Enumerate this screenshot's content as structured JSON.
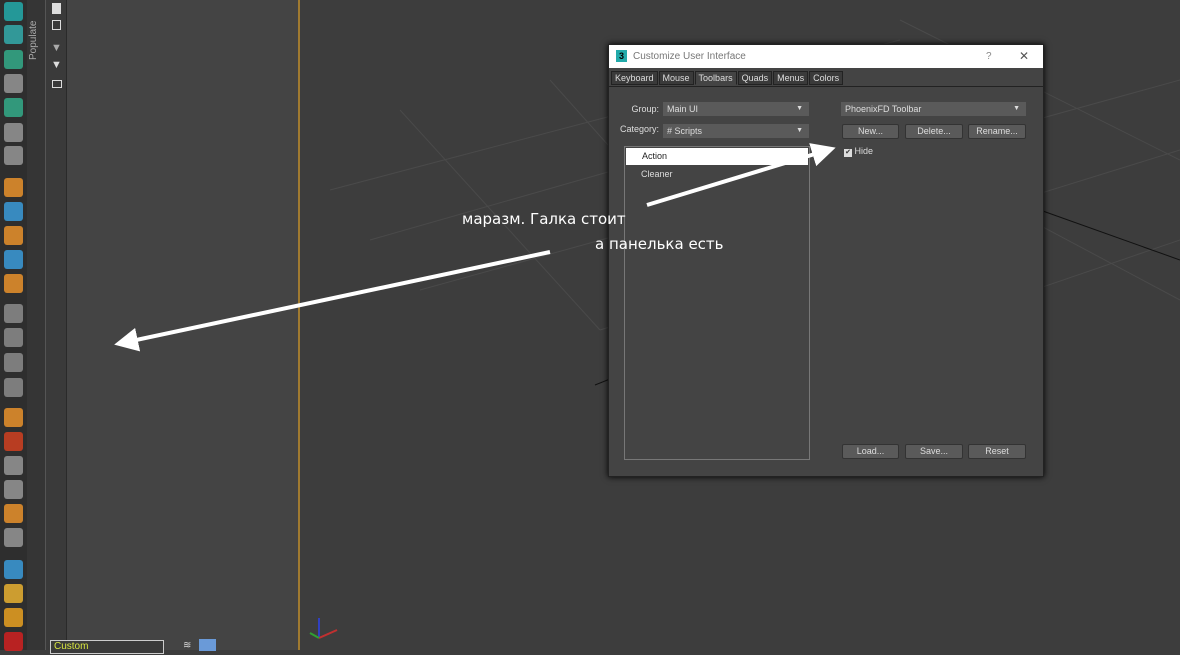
{
  "left_toolbar": {
    "icon_colors": [
      "#2aa",
      "#3aa",
      "#3a8",
      "#ddd",
      "#3a8",
      "#ddd",
      "#ddd",
      "#e8902a",
      "#3a9ad8",
      "#e8902a",
      "#3a9ad8",
      "#e8902a",
      "#ccc",
      "#ccc",
      "#ccc",
      "#ccc",
      "#e8902a",
      "#d04020",
      "#ddd",
      "#ddd",
      "#e8902a",
      "#ddd",
      "#3a9ad8",
      "#e8b030",
      "#e8a020",
      "#d02020"
    ]
  },
  "populate_label": "Populate",
  "layer_dropdown": {
    "value": "Custom"
  },
  "dialog": {
    "title": "Customize User Interface",
    "help": "?",
    "close": "✕",
    "tabs": [
      "Keyboard",
      "Mouse",
      "Toolbars",
      "Quads",
      "Menus",
      "Colors"
    ],
    "active_tab": "Toolbars",
    "group_label": "Group:",
    "group_value": "Main UI",
    "category_label": "Category:",
    "category_value": "# Scripts",
    "actions": [
      "Action",
      "Cleaner"
    ],
    "toolbar_value": "PhoenixFD Toolbar",
    "new": "New...",
    "delete": "Delete...",
    "rename": "Rename...",
    "hide_label": "Hide",
    "hide_checked": true,
    "load": "Load...",
    "save": "Save...",
    "reset": "Reset"
  },
  "annotation": {
    "line1": "маразм. Галка стоит",
    "line2": "а панелька есть"
  }
}
